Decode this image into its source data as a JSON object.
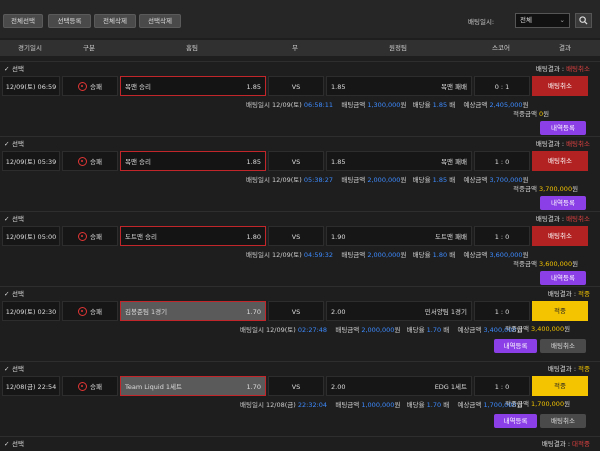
{
  "toolbar": {
    "buttons": [
      "전체선택",
      "선택등록",
      "전체삭제",
      "선택삭제"
    ],
    "date_label": "배팅일시:",
    "date_value": "전체"
  },
  "columns": [
    "경기일시",
    "구분",
    "홈팀",
    "무",
    "원정팀",
    "스코어",
    "결과"
  ],
  "common": {
    "select_label": "선택",
    "result_label": "배팅결과 :",
    "bet_time_label": "배팅일시",
    "amount_label": "배팅금액",
    "odds_label": "배당율",
    "expect_label": "예상금액",
    "hit_label": "적중금액",
    "won": "원",
    "bae": "배",
    "detail_btn": "내역등록",
    "cancel_btn": "배팅취소",
    "market": "승패",
    "draw": "VS"
  },
  "bets": [
    {
      "date": "12/09(토) 06:59",
      "home": "목맨 승리",
      "home_odds": "1.85",
      "away_odds": "1.85",
      "away": "목맨 패배",
      "score": "0 : 1",
      "result": "배팅취소",
      "status": "배팅취소",
      "bet_date": "12/09(토)",
      "bet_time": "06:58:11",
      "amount": "1,300,000",
      "odds": "1.85",
      "expect": "2,405,000",
      "hit": "0"
    },
    {
      "date": "12/09(토) 05:39",
      "home": "목맨 승리",
      "home_odds": "1.85",
      "away_odds": "1.85",
      "away": "목맨 패배",
      "score": "1 : 0",
      "result": "배팅취소",
      "status": "배팅취소",
      "bet_date": "12/09(토)",
      "bet_time": "05:38:27",
      "amount": "2,000,000",
      "odds": "1.85",
      "expect": "3,700,000",
      "hit": "3,700,000"
    },
    {
      "date": "12/09(토) 05:00",
      "home": "도트맨 승리",
      "home_odds": "1.80",
      "away_odds": "1.90",
      "away": "도트맨 패배",
      "score": "1 : 0",
      "result": "배팅취소",
      "status": "배팅취소",
      "bet_date": "12/09(토)",
      "bet_time": "04:59:32",
      "amount": "2,000,000",
      "odds": "1.80",
      "expect": "3,600,000",
      "hit": "3,600,000"
    },
    {
      "date": "12/09(토) 02:30",
      "home": "김봉준팀 1경기",
      "home_odds": "1.70",
      "away_odds": "2.00",
      "away": "민서양팀 1경기",
      "score": "1 : 0",
      "result": "적중",
      "status": "적중",
      "bet_date": "12/09(토)",
      "bet_time": "02:27:48",
      "amount": "2,000,000",
      "odds": "1.70",
      "expect": "3,400,000",
      "hit": "3,400,000"
    },
    {
      "date": "12/08(금) 22:54",
      "home": "Team Liquid 1세트",
      "home_odds": "1.70",
      "away_odds": "2.00",
      "away": "EDG 1세트",
      "score": "1 : 0",
      "result": "적중",
      "status": "적중",
      "bet_date": "12/08(금)",
      "bet_time": "22:32:04",
      "amount": "1,000,000",
      "odds": "1.70",
      "expect": "1,700,000",
      "hit": "1,700,000"
    }
  ],
  "last_block": {
    "status": "대적중"
  },
  "colors": {
    "cancel": "#b22222",
    "hit": "#f5c400",
    "purple": "#8b3fe6",
    "red_text": "#e04040",
    "blue_text": "#3d8bff"
  }
}
